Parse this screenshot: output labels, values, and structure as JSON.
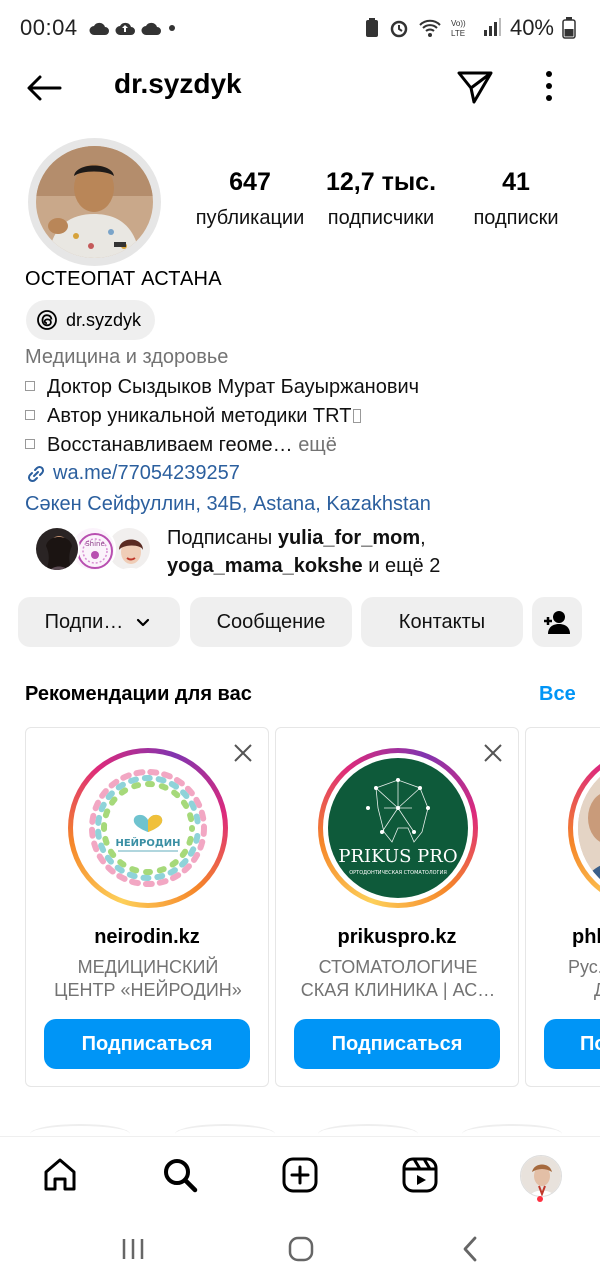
{
  "status_bar": {
    "time": "00:04",
    "battery": "40%",
    "network": "LTE"
  },
  "header": {
    "username": "dr.syzdyk",
    "icons": [
      "back-arrow-icon",
      "send-icon",
      "more-vertical-icon"
    ]
  },
  "profile": {
    "stats": [
      {
        "value": "647",
        "label": "публикации"
      },
      {
        "value": "12,7 тыс.",
        "label": "подписчики"
      },
      {
        "value": "41",
        "label": "подписки"
      }
    ],
    "display_name": "ОСТЕОПАТ АСТАНА",
    "threads_handle": "dr.syzdyk",
    "category": "Медицина и здоровье",
    "bio_lines": [
      "Доктор Сыздыков Мурат Бауыржанович",
      "Автор уникальной методики TRT",
      "Восстанавливаем геоме…"
    ],
    "bio_more": "ещё",
    "link": "wa.me/77054239257",
    "address": "Сәкен Сейфуллин, 34Б, Astana, Kazakhstan",
    "followed_by": {
      "prefix": "Подписаны ",
      "user1": "yulia_for_mom",
      "separator": ",",
      "user2": "yoga_mama_kokshe",
      "suffix": " и ещё 2"
    }
  },
  "actions": {
    "subscribed": "Подпи…",
    "message": "Сообщение",
    "contacts": "Контакты"
  },
  "recommendations": {
    "title": "Рекомендации для вас",
    "see_all": "Все",
    "cards": [
      {
        "username": "neirodin.kz",
        "desc_line1": "МЕДИЦИНСКИЙ",
        "desc_line2": "ЦЕНТР «НЕЙРОДИН»",
        "follow": "Подписаться",
        "logo_text": "НЕЙРОДИН"
      },
      {
        "username": "prikuspro.kz",
        "desc_line1": "СТОМАТОЛОГИЧЕ",
        "desc_line2": "СКАЯ КЛИНИКА | АС…",
        "follow": "Подписаться",
        "logo_text": "PRIKUS PRO",
        "logo_sub": "ОРТОДОНТИЧЕСКАЯ СТОМАТОЛОГИЯ"
      },
      {
        "username": "phl",
        "desc_line1": "Рус.",
        "desc_line2": "Д",
        "follow": "По"
      }
    ]
  },
  "colors": {
    "accent": "#0095f6",
    "link": "#2b5f9e",
    "muted": "#737373",
    "button_bg": "#efefef"
  }
}
